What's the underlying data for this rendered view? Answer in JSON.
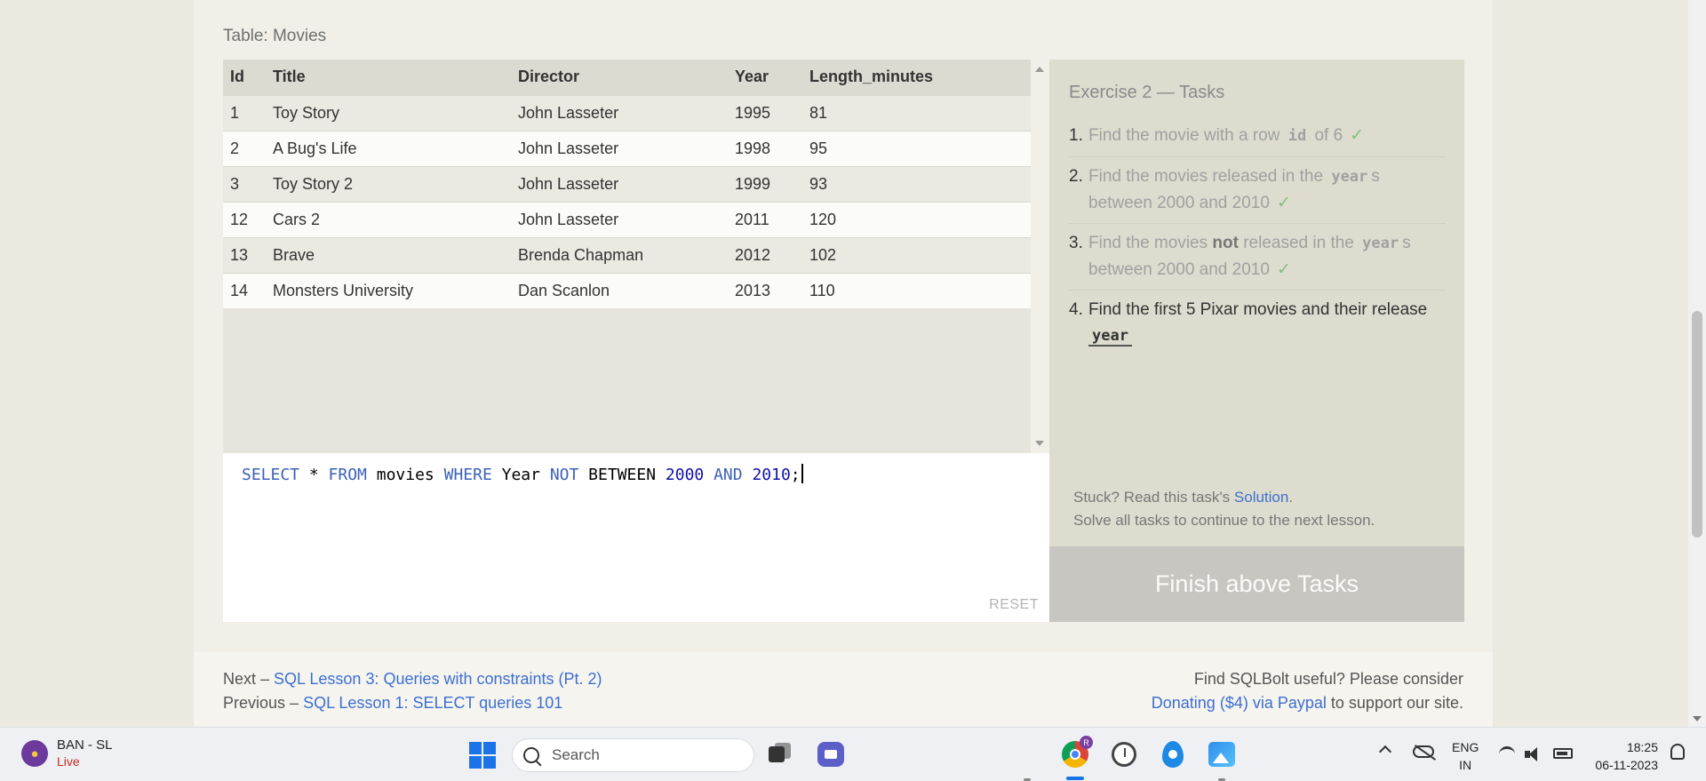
{
  "table_caption": "Table: Movies",
  "table": {
    "headers": [
      "Id",
      "Title",
      "Director",
      "Year",
      "Length_minutes"
    ],
    "rows": [
      [
        "1",
        "Toy Story",
        "John Lasseter",
        "1995",
        "81"
      ],
      [
        "2",
        "A Bug's Life",
        "John Lasseter",
        "1998",
        "95"
      ],
      [
        "3",
        "Toy Story 2",
        "John Lasseter",
        "1999",
        "93"
      ],
      [
        "12",
        "Cars 2",
        "John Lasseter",
        "2011",
        "120"
      ],
      [
        "13",
        "Brave",
        "Brenda Chapman",
        "2012",
        "102"
      ],
      [
        "14",
        "Monsters University",
        "Dan Scanlon",
        "2013",
        "110"
      ]
    ]
  },
  "editor": {
    "tokens": {
      "select": "SELECT",
      "star": " * ",
      "from": "FROM",
      "table": " movies ",
      "where": "WHERE",
      "column": " Year ",
      "not": "NOT",
      "between": " BETWEEN ",
      "n1": "2000",
      "and": " AND ",
      "n2": "2010",
      "end": ";"
    },
    "reset_label": "RESET"
  },
  "tasks": {
    "heading": "Exercise 2 — Tasks",
    "items": [
      {
        "num": "1.",
        "pre": "Find the movie with a row",
        "code": "id",
        "post": "of 6",
        "check": "✓"
      },
      {
        "num": "2.",
        "pre": "Find the movies released in the",
        "code": "year",
        "post": "s between 2000 and 2010",
        "check": "✓"
      },
      {
        "num": "3.",
        "pre": "Find the movies",
        "bold": "not",
        "mid": "released in the",
        "code": "year",
        "post": "s between 2000 and 2010",
        "check": "✓"
      },
      {
        "num": "4.",
        "pre": "Find the first 5 Pixar movies and their release",
        "code": "year"
      }
    ],
    "stuck_pre": "Stuck? Read this task's",
    "stuck_link": "Solution",
    "stuck_post": ".",
    "solve_all": "Solve all tasks to continue to the next lesson.",
    "finish_button": "Finish above Tasks"
  },
  "footer": {
    "next_prefix": "Next –",
    "next_link": "SQL Lesson 3: Queries with constraints (Pt. 2)",
    "prev_prefix": "Previous –",
    "prev_link": "SQL Lesson 1: SELECT queries 101",
    "support_line1": "Find SQLBolt useful? Please consider",
    "donate_link": "Donating ($4) via Paypal",
    "support_suffix": "to support our site."
  },
  "taskbar": {
    "widget_title": "BAN - SL",
    "widget_status": "Live",
    "search_label": "Search",
    "chrome_badge": "R",
    "lang_top": "ENG",
    "lang_bottom": "IN",
    "time": "18:25",
    "date": "06-11-2023"
  },
  "colors": {
    "link": "#3d6fd1",
    "sql_keyword": "#3b61b8",
    "sql_number": "#1111aa",
    "check": "#7ec47e",
    "live": "#c42b1c"
  }
}
